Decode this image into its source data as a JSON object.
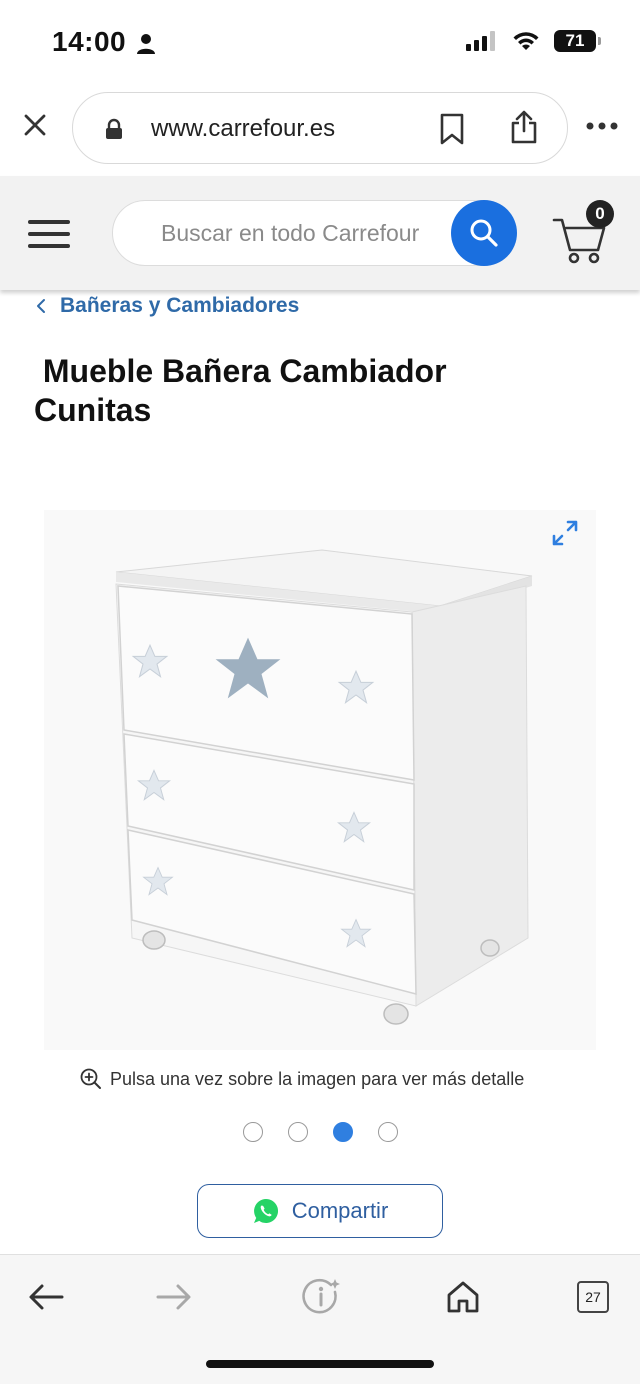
{
  "status": {
    "time": "14:00",
    "battery": "71"
  },
  "browser": {
    "url": "www.carrefour.es"
  },
  "header": {
    "search_placeholder": "Buscar en todo Carrefour",
    "cart_count": "0"
  },
  "breadcrumb": {
    "label": "Bañeras y Cambiadores"
  },
  "product": {
    "title": " Mueble Bañera Cambiador\nCunitas",
    "zoom_hint": "Pulsa una vez sobre la imagen para ver más detalle",
    "image_dots": {
      "count": 4,
      "active": 3
    },
    "share_label": "Compartir"
  },
  "toolbar": {
    "tab_count": "27"
  },
  "colors": {
    "carrefour_blue": "#1a6fdf",
    "link_blue": "#2f6aa8",
    "whatsapp_green": "#25d366",
    "dot_active": "#2f7fe0"
  }
}
